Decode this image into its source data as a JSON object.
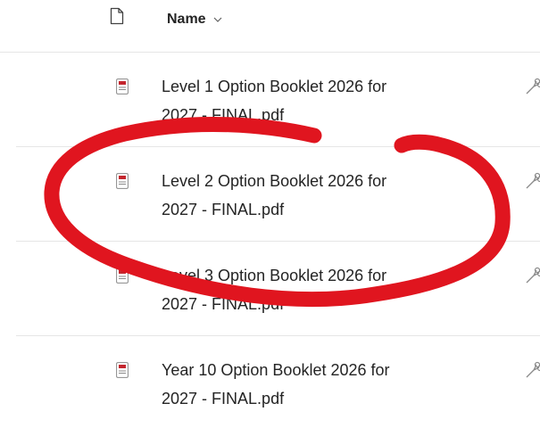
{
  "header": {
    "doc_icon": "document-icon",
    "name_label": "Name",
    "sort_icon": "chevron-down-icon"
  },
  "files": [
    {
      "name_line1": "Level 1 Option Booklet 2026 for",
      "name_line2": "2027 - FINAL.pdf",
      "icon": "pdf-file-icon",
      "action_icon": "share-icon"
    },
    {
      "name_line1": "Level 2 Option Booklet 2026 for",
      "name_line2": "2027 - FINAL.pdf",
      "icon": "pdf-file-icon",
      "action_icon": "share-icon"
    },
    {
      "name_line1": "Level 3 Option Booklet 2026 for",
      "name_line2": "2027 - FINAL.pdf",
      "icon": "pdf-file-icon",
      "action_icon": "share-icon"
    },
    {
      "name_line1": "Year 10 Option Booklet 2026 for",
      "name_line2": "2027 - FINAL.pdf",
      "icon": "pdf-file-icon",
      "action_icon": "share-icon"
    }
  ],
  "colors": {
    "annotation": "#e0151f",
    "pdf_red": "#c4262e",
    "text": "#242424",
    "divider": "#e6e6e6"
  }
}
